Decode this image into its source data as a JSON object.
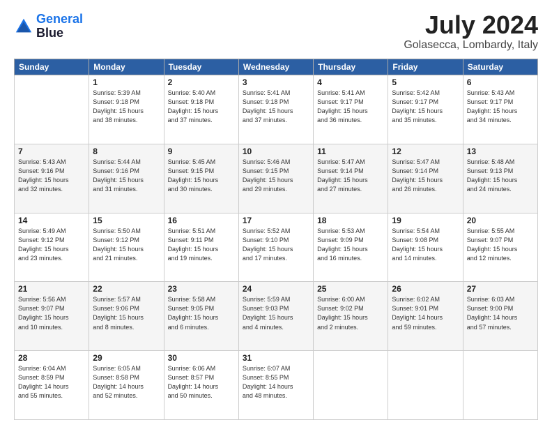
{
  "header": {
    "logo_line1": "General",
    "logo_line2": "Blue",
    "month": "July 2024",
    "location": "Golasecca, Lombardy, Italy"
  },
  "days_of_week": [
    "Sunday",
    "Monday",
    "Tuesday",
    "Wednesday",
    "Thursday",
    "Friday",
    "Saturday"
  ],
  "weeks": [
    [
      {
        "day": "",
        "info": ""
      },
      {
        "day": "1",
        "info": "Sunrise: 5:39 AM\nSunset: 9:18 PM\nDaylight: 15 hours\nand 38 minutes."
      },
      {
        "day": "2",
        "info": "Sunrise: 5:40 AM\nSunset: 9:18 PM\nDaylight: 15 hours\nand 37 minutes."
      },
      {
        "day": "3",
        "info": "Sunrise: 5:41 AM\nSunset: 9:18 PM\nDaylight: 15 hours\nand 37 minutes."
      },
      {
        "day": "4",
        "info": "Sunrise: 5:41 AM\nSunset: 9:17 PM\nDaylight: 15 hours\nand 36 minutes."
      },
      {
        "day": "5",
        "info": "Sunrise: 5:42 AM\nSunset: 9:17 PM\nDaylight: 15 hours\nand 35 minutes."
      },
      {
        "day": "6",
        "info": "Sunrise: 5:43 AM\nSunset: 9:17 PM\nDaylight: 15 hours\nand 34 minutes."
      }
    ],
    [
      {
        "day": "7",
        "info": "Sunrise: 5:43 AM\nSunset: 9:16 PM\nDaylight: 15 hours\nand 32 minutes."
      },
      {
        "day": "8",
        "info": "Sunrise: 5:44 AM\nSunset: 9:16 PM\nDaylight: 15 hours\nand 31 minutes."
      },
      {
        "day": "9",
        "info": "Sunrise: 5:45 AM\nSunset: 9:15 PM\nDaylight: 15 hours\nand 30 minutes."
      },
      {
        "day": "10",
        "info": "Sunrise: 5:46 AM\nSunset: 9:15 PM\nDaylight: 15 hours\nand 29 minutes."
      },
      {
        "day": "11",
        "info": "Sunrise: 5:47 AM\nSunset: 9:14 PM\nDaylight: 15 hours\nand 27 minutes."
      },
      {
        "day": "12",
        "info": "Sunrise: 5:47 AM\nSunset: 9:14 PM\nDaylight: 15 hours\nand 26 minutes."
      },
      {
        "day": "13",
        "info": "Sunrise: 5:48 AM\nSunset: 9:13 PM\nDaylight: 15 hours\nand 24 minutes."
      }
    ],
    [
      {
        "day": "14",
        "info": "Sunrise: 5:49 AM\nSunset: 9:12 PM\nDaylight: 15 hours\nand 23 minutes."
      },
      {
        "day": "15",
        "info": "Sunrise: 5:50 AM\nSunset: 9:12 PM\nDaylight: 15 hours\nand 21 minutes."
      },
      {
        "day": "16",
        "info": "Sunrise: 5:51 AM\nSunset: 9:11 PM\nDaylight: 15 hours\nand 19 minutes."
      },
      {
        "day": "17",
        "info": "Sunrise: 5:52 AM\nSunset: 9:10 PM\nDaylight: 15 hours\nand 17 minutes."
      },
      {
        "day": "18",
        "info": "Sunrise: 5:53 AM\nSunset: 9:09 PM\nDaylight: 15 hours\nand 16 minutes."
      },
      {
        "day": "19",
        "info": "Sunrise: 5:54 AM\nSunset: 9:08 PM\nDaylight: 15 hours\nand 14 minutes."
      },
      {
        "day": "20",
        "info": "Sunrise: 5:55 AM\nSunset: 9:07 PM\nDaylight: 15 hours\nand 12 minutes."
      }
    ],
    [
      {
        "day": "21",
        "info": "Sunrise: 5:56 AM\nSunset: 9:07 PM\nDaylight: 15 hours\nand 10 minutes."
      },
      {
        "day": "22",
        "info": "Sunrise: 5:57 AM\nSunset: 9:06 PM\nDaylight: 15 hours\nand 8 minutes."
      },
      {
        "day": "23",
        "info": "Sunrise: 5:58 AM\nSunset: 9:05 PM\nDaylight: 15 hours\nand 6 minutes."
      },
      {
        "day": "24",
        "info": "Sunrise: 5:59 AM\nSunset: 9:03 PM\nDaylight: 15 hours\nand 4 minutes."
      },
      {
        "day": "25",
        "info": "Sunrise: 6:00 AM\nSunset: 9:02 PM\nDaylight: 15 hours\nand 2 minutes."
      },
      {
        "day": "26",
        "info": "Sunrise: 6:02 AM\nSunset: 9:01 PM\nDaylight: 14 hours\nand 59 minutes."
      },
      {
        "day": "27",
        "info": "Sunrise: 6:03 AM\nSunset: 9:00 PM\nDaylight: 14 hours\nand 57 minutes."
      }
    ],
    [
      {
        "day": "28",
        "info": "Sunrise: 6:04 AM\nSunset: 8:59 PM\nDaylight: 14 hours\nand 55 minutes."
      },
      {
        "day": "29",
        "info": "Sunrise: 6:05 AM\nSunset: 8:58 PM\nDaylight: 14 hours\nand 52 minutes."
      },
      {
        "day": "30",
        "info": "Sunrise: 6:06 AM\nSunset: 8:57 PM\nDaylight: 14 hours\nand 50 minutes."
      },
      {
        "day": "31",
        "info": "Sunrise: 6:07 AM\nSunset: 8:55 PM\nDaylight: 14 hours\nand 48 minutes."
      },
      {
        "day": "",
        "info": ""
      },
      {
        "day": "",
        "info": ""
      },
      {
        "day": "",
        "info": ""
      }
    ]
  ]
}
